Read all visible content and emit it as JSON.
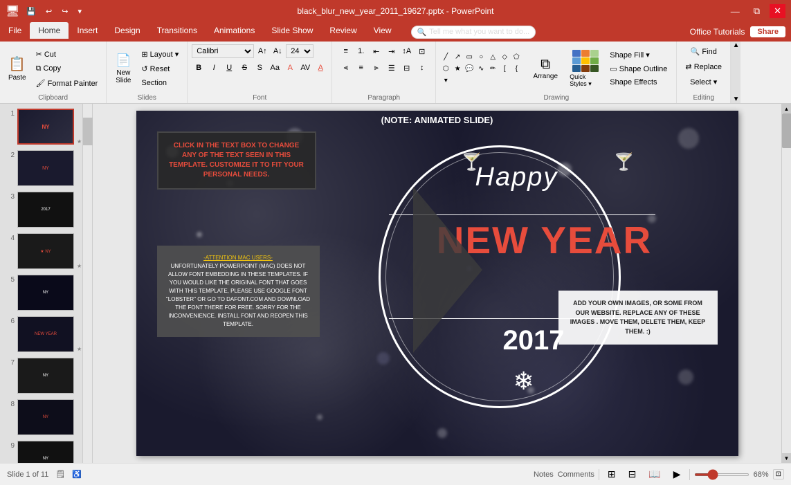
{
  "titlebar": {
    "filename": "black_blur_new_year_2011_19627.pptx - PowerPoint",
    "minimize": "—",
    "maximize": "□",
    "close": "✕",
    "restore": "⧉"
  },
  "qat": {
    "save": "💾",
    "undo": "↩",
    "redo": "↪",
    "more": "▾"
  },
  "tabs": {
    "items": [
      "File",
      "Home",
      "Insert",
      "Design",
      "Transitions",
      "Animations",
      "Slide Show",
      "Review",
      "View"
    ]
  },
  "ribbon": {
    "clipboard": {
      "label": "Clipboard",
      "paste": "Paste",
      "cut": "✂",
      "copy": "⧉",
      "format_painter": "🖌"
    },
    "slides": {
      "label": "Slides",
      "new_slide": "New\nSlide",
      "layout": "Layout",
      "reset": "Reset",
      "section": "Section"
    },
    "font": {
      "label": "Font",
      "name": "Calibri",
      "size": "24",
      "bold": "B",
      "italic": "I",
      "underline": "U",
      "strikethrough": "S",
      "shadow": "S",
      "clear": "A",
      "color": "A",
      "increase": "A↑",
      "decrease": "A↓",
      "change_case": "Aa"
    },
    "paragraph": {
      "label": "Paragraph"
    },
    "drawing": {
      "label": "Drawing",
      "arrange": "Arrange",
      "quick_styles": "Quick Styles",
      "shape_fill": "Shape Fill ▾",
      "shape_outline": "Shape Outline",
      "shape_effects": "Shape Effects"
    },
    "editing": {
      "label": "Editing",
      "find": "Find",
      "replace": "Replace",
      "select": "Select ▾"
    }
  },
  "tell_me": {
    "placeholder": "Tell me what you want to do..."
  },
  "header_right": {
    "office_tutorials": "Office Tutorials",
    "share": "Share"
  },
  "slides": [
    {
      "num": "1",
      "active": true,
      "star": "★"
    },
    {
      "num": "2",
      "active": false,
      "star": ""
    },
    {
      "num": "3",
      "active": false,
      "star": ""
    },
    {
      "num": "4",
      "active": false,
      "star": "★"
    },
    {
      "num": "5",
      "active": false,
      "star": ""
    },
    {
      "num": "6",
      "active": false,
      "star": "★"
    },
    {
      "num": "7",
      "active": false,
      "star": ""
    },
    {
      "num": "8",
      "active": false,
      "star": ""
    },
    {
      "num": "9",
      "active": false,
      "star": ""
    }
  ],
  "slide_content": {
    "note_animated": "(NOTE: ANIMATED SLIDE)",
    "red_box_text": "CLICK IN THE TEXT BOX TO CHANGE ANY OF THE TEXT SEEN IN THIS TEMPLATE. CUSTOMIZE IT TO FIT YOUR PERSONAL NEEDS.",
    "attention_label": "-ATTENTION MAC USERS-",
    "gray_box_text": "UNFORTUNATELY POWERPOINT (MAC) DOES NOT ALLOW FONT EMBEDDING IN THESE TEMPLATES. IF YOU WOULD LIKE THE ORIGINAL FONT THAT GOES WITH THIS TEMPLATE, PLEASE USE GOOGLE FONT \"LOBSTER\" OR GO TO DAFONT.COM AND DOWNLOAD THE FONT THERE FOR FREE. SORRY FOR THE INCONVENIENCE. INSTALL FONT AND REOPEN THIS TEMPLATE.",
    "happy": "Happy",
    "new_year": "NEW YEAR",
    "year": "2017",
    "snowflake": "❄",
    "white_box_text": "ADD YOUR OWN IMAGES, OR SOME FROM OUR WEBSITE. REPLACE ANY OF THESE IMAGES . MOVE THEM, DELETE THEM, KEEP THEM. :)"
  },
  "statusbar": {
    "slide_info": "Slide 1 of 11",
    "notes": "Notes",
    "comments": "Comments",
    "zoom": "68%"
  }
}
